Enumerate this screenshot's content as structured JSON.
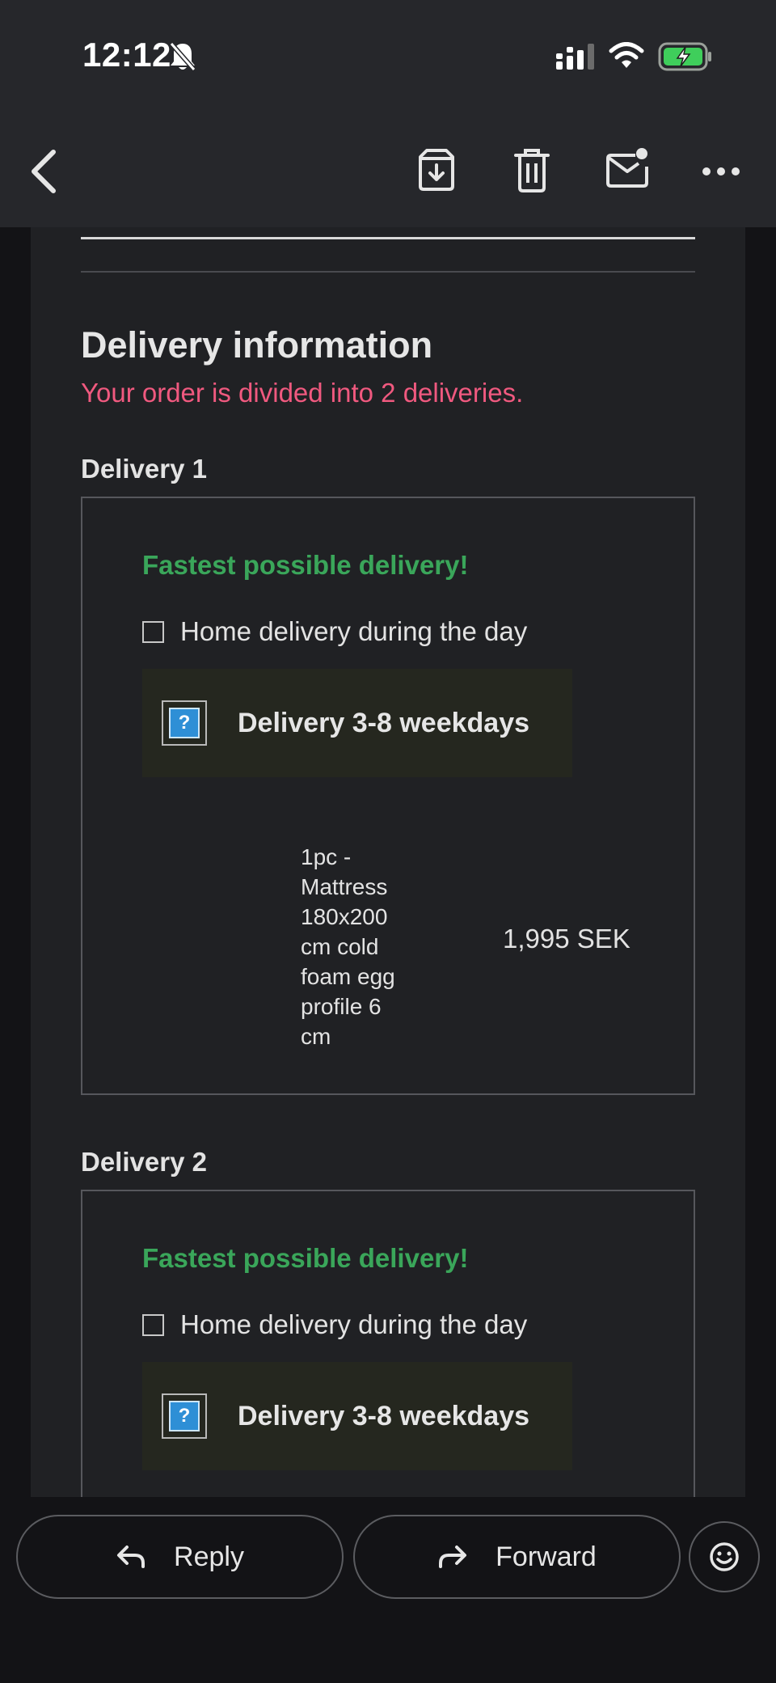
{
  "status_bar": {
    "time": "12:12",
    "icons": [
      "bell-slash-icon",
      "cellular-signal-icon",
      "wifi-icon",
      "battery-charging-icon"
    ]
  },
  "toolbar": {
    "back_icon": "chevron-left-icon",
    "actions": [
      "archive-icon",
      "trash-icon",
      "mark-unread-icon",
      "more-options-icon"
    ]
  },
  "email": {
    "section_title": "Delivery information",
    "section_subtitle": "Your order is divided into 2 deliveries.",
    "deliveries": [
      {
        "label": "Delivery 1",
        "fastest": "Fastest possible delivery!",
        "home_delivery": "Home delivery during the day",
        "delivery_time": "Delivery 3-8 weekdays",
        "item_lines": [
          "1pc -",
          "Mattress",
          "180x200",
          "cm cold",
          "foam egg",
          "profile 6",
          "cm"
        ],
        "item_price": "1,995 SEK"
      },
      {
        "label": "Delivery 2",
        "fastest": "Fastest possible delivery!",
        "home_delivery": "Home delivery during the day",
        "delivery_time": "Delivery 3-8 weekdays"
      }
    ]
  },
  "actions": {
    "reply_label": "Reply",
    "forward_label": "Forward",
    "emoji_icon": "emoji-reaction-icon"
  },
  "colors": {
    "background": "#131316",
    "card": "#202124",
    "toolbar": "#26272b",
    "accent_pink": "#f0597f",
    "accent_green": "#3aa65a",
    "delivery_time_bg": "#25271f"
  }
}
